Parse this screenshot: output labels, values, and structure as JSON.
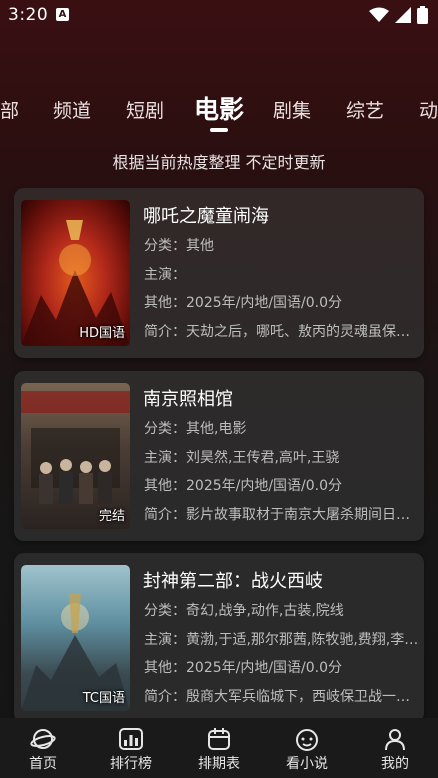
{
  "status": {
    "time": "3:20",
    "notification_glyph": "A"
  },
  "tabs": {
    "items": [
      "部",
      "频道",
      "短剧",
      "电影",
      "剧集",
      "综艺",
      "动"
    ],
    "active": "电影"
  },
  "subtitle": "根据当前热度整理 不定时更新",
  "cards": [
    {
      "title": "哪吒之魔童闹海",
      "category": "分类：其他",
      "cast": "主演：",
      "other": "其他：2025年/内地/国语/0.0分",
      "intro": "简介：天劫之后，哪吒、敖丙的灵魂虽保住了，但肉身很快会魂飞魄散",
      "badge": "HD国语",
      "poster_colors": [
        "#c5361a",
        "#5a0c08"
      ]
    },
    {
      "title": "南京照相馆",
      "category": "分类：其他,电影",
      "cast": "主演：刘昊然,王传君,高叶,王骁",
      "other": "其他：2025年/内地/国语/0.0分",
      "intro": "简介：影片故事取材于南京大屠杀期间日军真实罪证",
      "badge": "完结",
      "poster_colors": [
        "#6e5a4a",
        "#2a2320"
      ]
    },
    {
      "title": "封神第二部：战火西岐",
      "category": "分类：奇幻,战争,动作,古装,院线",
      "cast": "主演：黄渤,于适,那尔那茜,陈牧驰,费翔,李雪健",
      "other": "其他：2025年/内地/国语/0.0分",
      "intro": "简介：殷商大军兵临城下，西岐保卫战一触即发",
      "badge": "TC国语",
      "poster_colors": [
        "#5f8fa0",
        "#2f3d44"
      ]
    }
  ],
  "nav": [
    {
      "label": "首页",
      "icon": "home-planet-icon"
    },
    {
      "label": "排行榜",
      "icon": "ranking-chart-icon"
    },
    {
      "label": "排期表",
      "icon": "schedule-calendar-icon"
    },
    {
      "label": "看小说",
      "icon": "novel-face-icon"
    },
    {
      "label": "我的",
      "icon": "profile-person-icon"
    }
  ]
}
